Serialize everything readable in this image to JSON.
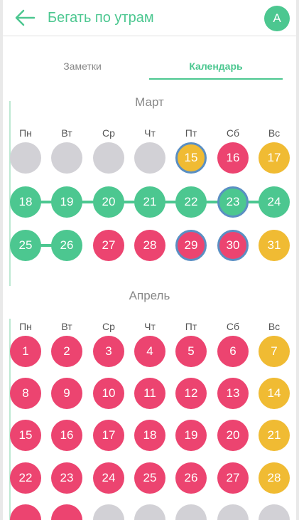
{
  "header": {
    "title": "Бегать по утрам",
    "avatar_letter": "A"
  },
  "tabs": {
    "notes": "Заметки",
    "calendar": "Календарь"
  },
  "weekdays": [
    "Пн",
    "Вт",
    "Ср",
    "Чт",
    "Пт",
    "Сб",
    "Вс"
  ],
  "colors": {
    "green": "#4cc790",
    "red": "#ec4470",
    "yellow": "#f0bb33",
    "gray": "#d2d1d6",
    "selected_ring": "#5a8fc3"
  },
  "months": [
    {
      "name": "Март",
      "rows": [
        [
          {
            "day": "",
            "status": "empty"
          },
          {
            "day": "",
            "status": "empty"
          },
          {
            "day": "",
            "status": "empty"
          },
          {
            "day": "",
            "status": "empty"
          },
          {
            "day": "15",
            "status": "yellow",
            "selected": true
          },
          {
            "day": "16",
            "status": "red"
          },
          {
            "day": "17",
            "status": "yellow"
          }
        ],
        [
          {
            "day": "18",
            "status": "green"
          },
          {
            "day": "19",
            "status": "green"
          },
          {
            "day": "20",
            "status": "green"
          },
          {
            "day": "21",
            "status": "green"
          },
          {
            "day": "22",
            "status": "green"
          },
          {
            "day": "23",
            "status": "green",
            "selected": true
          },
          {
            "day": "24",
            "status": "green"
          }
        ],
        [
          {
            "day": "25",
            "status": "green"
          },
          {
            "day": "26",
            "status": "green"
          },
          {
            "day": "27",
            "status": "red"
          },
          {
            "day": "28",
            "status": "red"
          },
          {
            "day": "29",
            "status": "red",
            "selected": true
          },
          {
            "day": "30",
            "status": "red",
            "selected": true
          },
          {
            "day": "31",
            "status": "yellow"
          }
        ]
      ]
    },
    {
      "name": "Апрель",
      "rows": [
        [
          {
            "day": "1",
            "status": "red"
          },
          {
            "day": "2",
            "status": "red"
          },
          {
            "day": "3",
            "status": "red"
          },
          {
            "day": "4",
            "status": "red"
          },
          {
            "day": "5",
            "status": "red"
          },
          {
            "day": "6",
            "status": "red"
          },
          {
            "day": "7",
            "status": "yellow"
          }
        ],
        [
          {
            "day": "8",
            "status": "red"
          },
          {
            "day": "9",
            "status": "red"
          },
          {
            "day": "10",
            "status": "red"
          },
          {
            "day": "11",
            "status": "red"
          },
          {
            "day": "12",
            "status": "red"
          },
          {
            "day": "13",
            "status": "red"
          },
          {
            "day": "14",
            "status": "yellow"
          }
        ],
        [
          {
            "day": "15",
            "status": "red"
          },
          {
            "day": "16",
            "status": "red"
          },
          {
            "day": "17",
            "status": "red"
          },
          {
            "day": "18",
            "status": "red"
          },
          {
            "day": "19",
            "status": "red"
          },
          {
            "day": "20",
            "status": "red"
          },
          {
            "day": "21",
            "status": "yellow"
          }
        ],
        [
          {
            "day": "22",
            "status": "red"
          },
          {
            "day": "23",
            "status": "red"
          },
          {
            "day": "24",
            "status": "red"
          },
          {
            "day": "25",
            "status": "red"
          },
          {
            "day": "26",
            "status": "red"
          },
          {
            "day": "27",
            "status": "red"
          },
          {
            "day": "28",
            "status": "yellow"
          }
        ],
        [
          {
            "day": "",
            "status": "red"
          },
          {
            "day": "",
            "status": "red"
          },
          {
            "day": "",
            "status": "empty"
          },
          {
            "day": "",
            "status": "empty"
          },
          {
            "day": "",
            "status": "empty"
          },
          {
            "day": "",
            "status": "empty"
          },
          {
            "day": "",
            "status": "empty"
          }
        ]
      ]
    }
  ]
}
